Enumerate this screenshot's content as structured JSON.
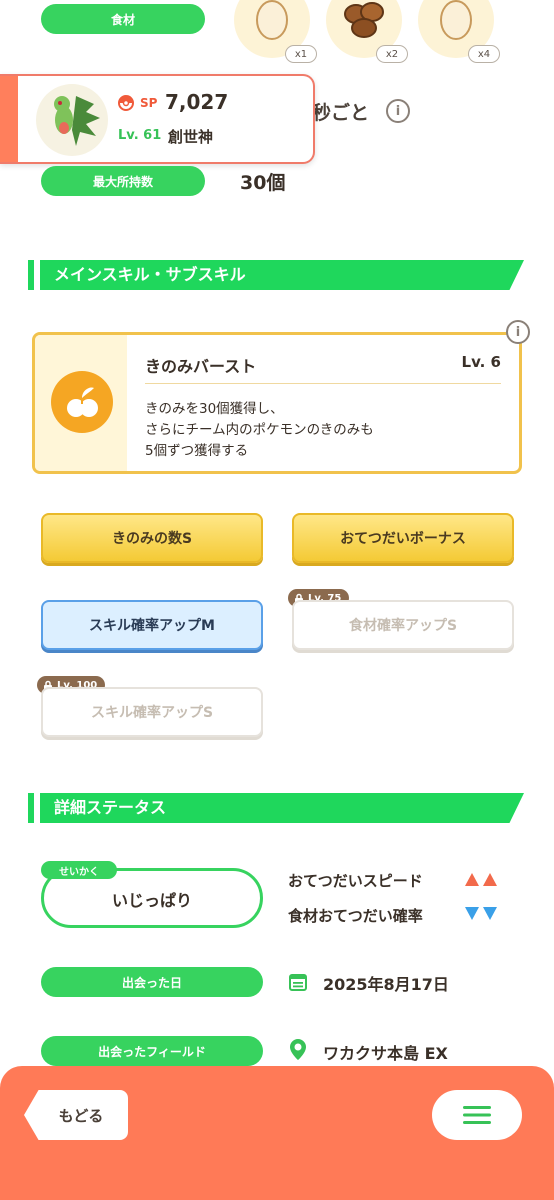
{
  "top": {
    "ingredient_label": "食材",
    "ingredients": [
      {
        "icon": "egg-icon",
        "count": "x1"
      },
      {
        "icon": "nuts-icon",
        "count": "x2"
      },
      {
        "icon": "egg-icon",
        "count": "x4"
      }
    ],
    "freq_partial": "秒ごと",
    "max_carry_label": "最大所持数",
    "max_carry_value": "30個"
  },
  "pokemon_card": {
    "sp_label": "SP",
    "sp_value": "7,027",
    "level": "Lv. 61",
    "title": "創世神"
  },
  "skills_section": {
    "title": "メインスキル・サブスキル",
    "main_skill": {
      "name": "きのみバースト",
      "level": "Lv. 6",
      "desc1": "きのみを30個獲得し、",
      "desc2": "さらにチーム内のポケモンのきのみも",
      "desc3": "5個ずつ獲得する"
    },
    "sub_skills": [
      {
        "label": "きのみの数S",
        "style": "gold"
      },
      {
        "label": "おてつだいボーナス",
        "style": "gold"
      },
      {
        "label": "スキル確率アップM",
        "style": "blue"
      },
      {
        "label": "食材確率アップS",
        "style": "locked",
        "lock": "Lv. 75"
      },
      {
        "label": "スキル確率アップS",
        "style": "locked",
        "lock": "Lv. 100"
      }
    ]
  },
  "details_section": {
    "title": "詳細ステータス",
    "nature_tag": "せいかく",
    "nature": "いじっぱり",
    "nature_up": "おてつだいスピード",
    "nature_down": "食材おてつだい確率",
    "met_date_label": "出会った日",
    "met_date": "2025年8月17日",
    "met_field_label": "出会ったフィールド",
    "met_field": "ワカクサ本島 EX"
  },
  "bottom": {
    "back_label": "もどる"
  },
  "colors": {
    "green": "#37d35f",
    "coral": "#ff7a57",
    "gold": "#f4ca35",
    "up": "#f26a4b",
    "down": "#3aa0e8"
  }
}
